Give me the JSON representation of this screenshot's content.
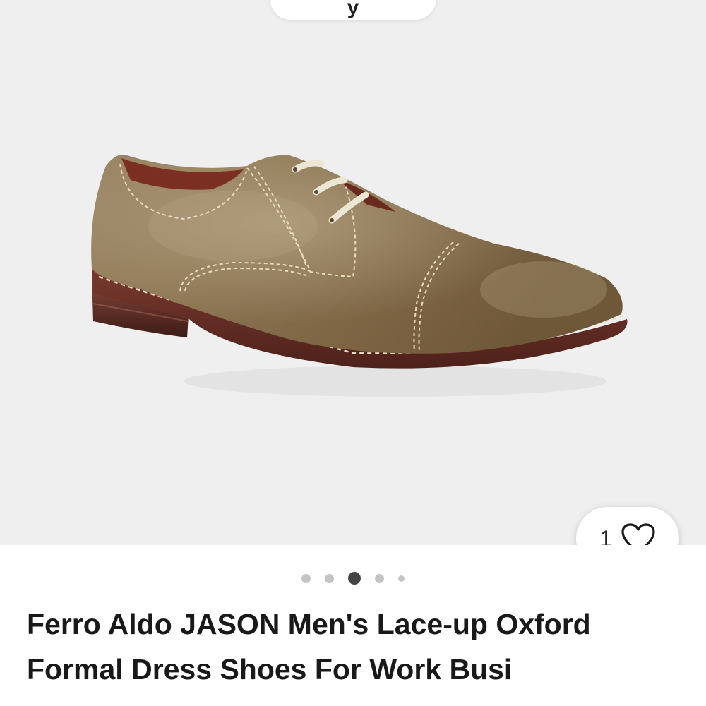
{
  "gallery": {
    "top_chip_text": "y",
    "image_alt": "Ferro Aldo JASON Men's Lace-up Oxford Formal Dress Shoes brown leather",
    "like_count": "1",
    "slide_count": 5,
    "active_slide": 3
  },
  "product": {
    "title": "Ferro Aldo JASON Men's Lace-up Oxford Formal Dress Shoes For Work Busi"
  },
  "colors": {
    "gallery_background": "#efefef",
    "shoe_leather": "#8a7352",
    "sole": "#6e2e26",
    "laces": "#ece6d4",
    "active_dot": "#444444",
    "inactive_dot": "#c4c4c4"
  }
}
